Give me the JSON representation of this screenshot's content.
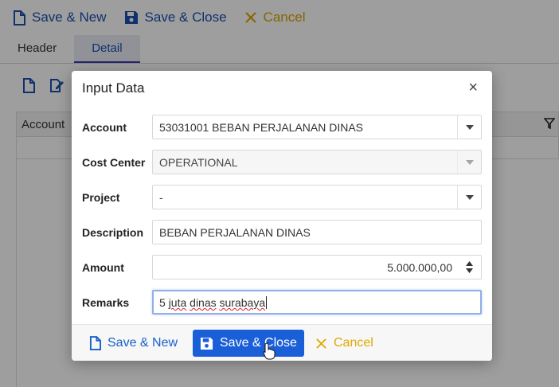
{
  "toolbar": {
    "save_new_label": "Save & New",
    "save_close_label": "Save & Close",
    "cancel_label": "Cancel"
  },
  "tabs": [
    {
      "label": "Header",
      "active": false
    },
    {
      "label": "Detail",
      "active": true
    }
  ],
  "grid": {
    "column_account": "Account"
  },
  "dialog": {
    "title": "Input Data",
    "close_glyph": "×",
    "fields": {
      "account": {
        "label": "Account",
        "value": "53031001 BEBAN PERJALANAN DINAS"
      },
      "cost_center": {
        "label": "Cost Center",
        "value": "OPERATIONAL"
      },
      "project": {
        "label": "Project",
        "value": "-"
      },
      "description": {
        "label": "Description",
        "value": "BEBAN PERJALANAN DINAS"
      },
      "amount": {
        "label": "Amount",
        "value": "5.000.000,00"
      },
      "remarks": {
        "label": "Remarks",
        "value_plain1": "5 ",
        "value_misspelled1": "juta",
        "value_plain2": " ",
        "value_misspelled2": "dinas",
        "value_plain3": " ",
        "value_misspelled3": "surabaya"
      }
    },
    "footer": {
      "save_new_label": "Save & New",
      "save_close_label": "Save & Close",
      "cancel_label": "Cancel"
    }
  },
  "colors": {
    "primary": "#1a5fd8",
    "cancel": "#e0a800",
    "overlay": "rgba(0,0,0,0.38)"
  },
  "icons": [
    "file-icon",
    "save-icon",
    "x-icon",
    "edit-icon",
    "filter-icon",
    "chevron-down-icon",
    "spin-up-icon",
    "spin-down-icon",
    "hand-cursor-icon"
  ]
}
